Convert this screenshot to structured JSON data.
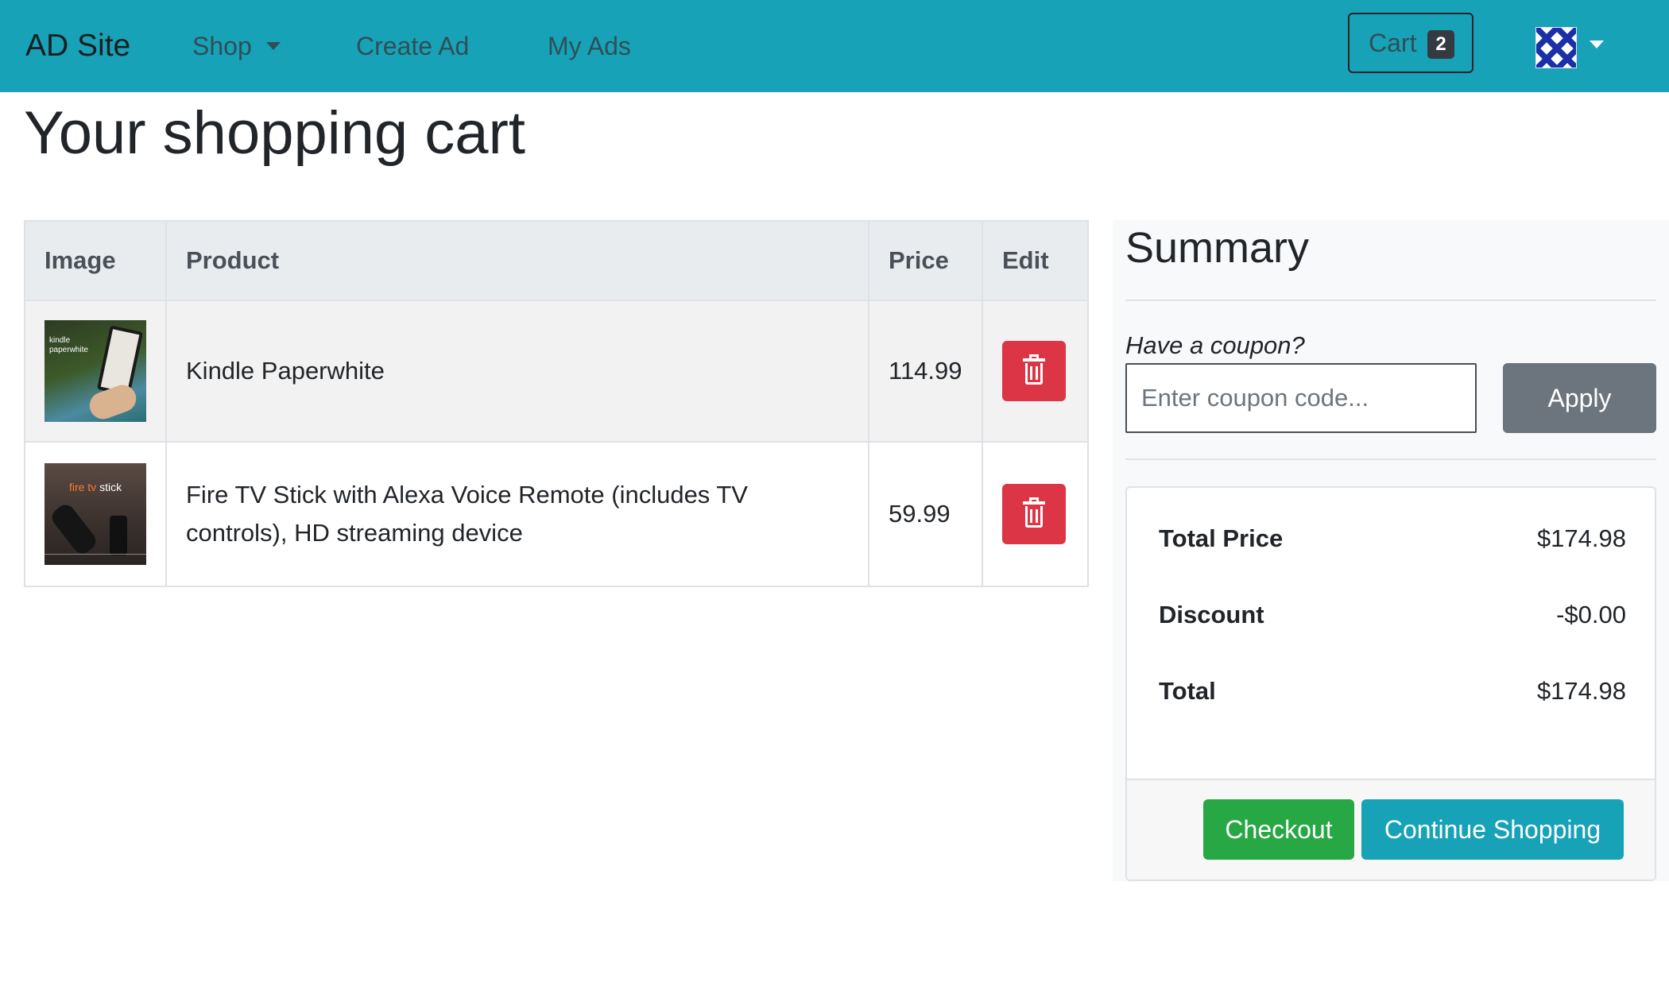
{
  "navbar": {
    "brand": "AD Site",
    "links": [
      {
        "label": "Shop",
        "has_dropdown": true
      },
      {
        "label": "Create Ad"
      },
      {
        "label": "My Ads"
      }
    ],
    "cart_label": "Cart",
    "cart_count": "2",
    "bg_color": "#17a2b8"
  },
  "page": {
    "title": "Your shopping cart"
  },
  "cart": {
    "headers": [
      "Image",
      "Product",
      "Price",
      "Edit"
    ],
    "items": [
      {
        "product": "Kindle Paperwhite",
        "price": "114.99",
        "thumb_text": "kindle paperwhite",
        "image_icon": "kindle-image"
      },
      {
        "product": "Fire TV Stick with Alexa Voice Remote (includes TV controls), HD streaming device",
        "price": "59.99",
        "thumb_brand": "fire tv",
        "thumb_word": "stick",
        "image_icon": "fire-tv-stick-image"
      }
    ],
    "delete_icon": "trash-icon",
    "delete_color": "#dc3545"
  },
  "summary": {
    "title": "Summary",
    "coupon_label": "Have a coupon?",
    "coupon_placeholder": "Enter coupon code...",
    "coupon_value": "",
    "apply_label": "Apply",
    "rows": [
      {
        "label": "Total Price",
        "value": "$174.98"
      },
      {
        "label": "Discount",
        "value": "-$0.00"
      },
      {
        "label": "Total",
        "value": "$174.98"
      }
    ],
    "checkout_label": "Checkout",
    "continue_label": "Continue Shopping"
  }
}
